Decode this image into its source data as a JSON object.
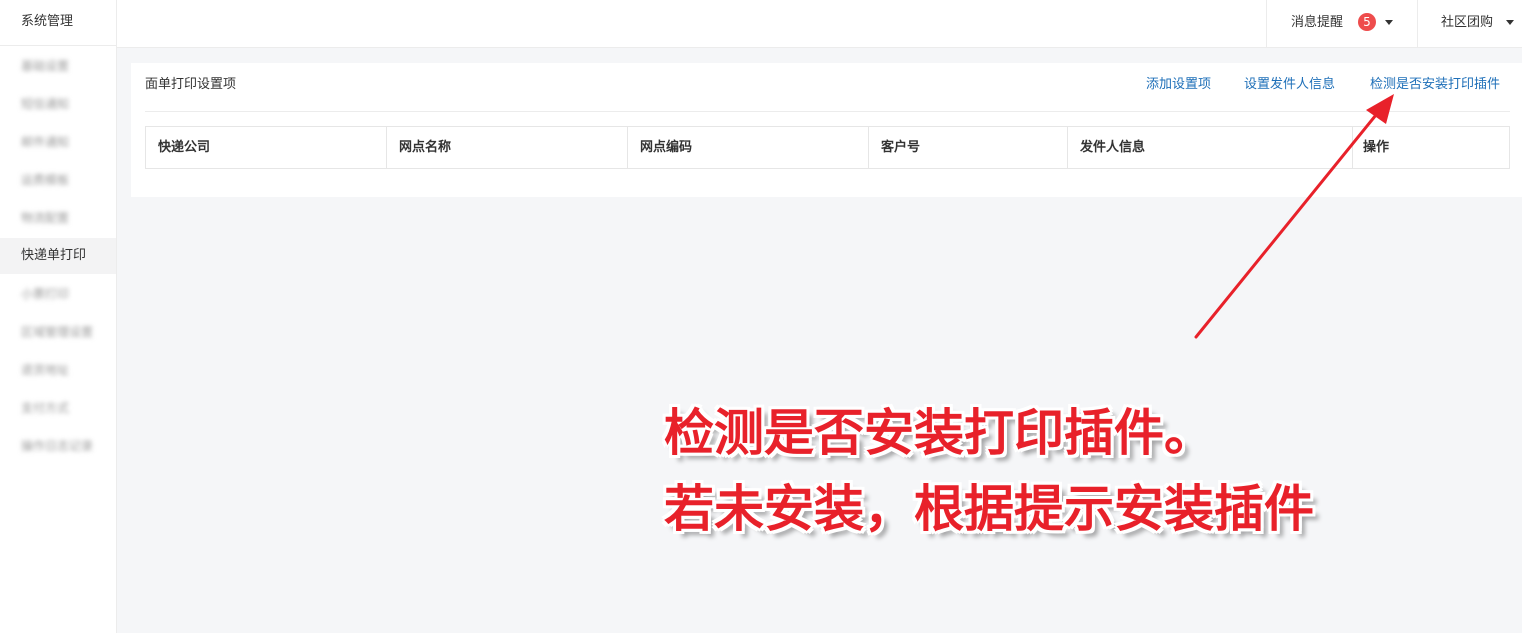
{
  "sidebar": {
    "title": "系统管理",
    "items": [
      {
        "label": "基础设置"
      },
      {
        "label": "短信通知"
      },
      {
        "label": "邮件通知"
      },
      {
        "label": "运费模板"
      },
      {
        "label": "物流配置"
      },
      {
        "label": "快递单打印"
      },
      {
        "label": "小票打印"
      },
      {
        "label": "区域管理设置"
      },
      {
        "label": "退货地址"
      },
      {
        "label": "支付方式"
      },
      {
        "label": "操作日志记录"
      }
    ]
  },
  "topbar": {
    "messages_label": "消息提醒",
    "messages_count": "5",
    "community_label": "社区团购"
  },
  "card": {
    "title": "面单打印设置项",
    "links": {
      "add": "添加设置项",
      "sender": "设置发件人信息",
      "check_plugin": "检测是否安装打印插件"
    },
    "columns": [
      "快递公司",
      "网点名称",
      "网点编码",
      "客户号",
      "发件人信息",
      "操作"
    ]
  },
  "annotation": {
    "line1": "检测是否安装打印插件。",
    "line2": "若未安装，根据提示安装插件",
    "color": "#e8212a"
  },
  "colors": {
    "link": "#1e6fb8",
    "badge": "#ee4c4c",
    "background": "#f5f6f8"
  }
}
